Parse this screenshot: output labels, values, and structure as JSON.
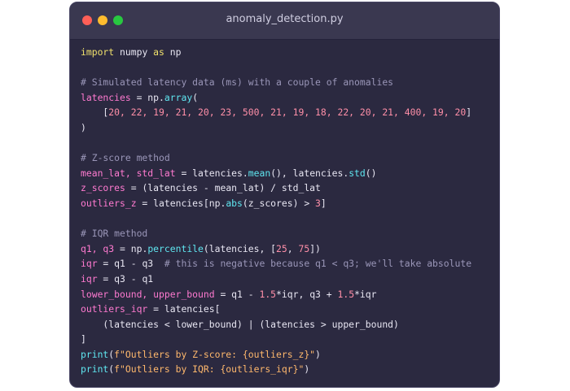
{
  "window": {
    "title": "anomaly_detection.py"
  },
  "code_lines": [
    [
      {
        "t": "import",
        "c": "kw"
      },
      {
        "t": " numpy ",
        "c": "plain"
      },
      {
        "t": "as",
        "c": "kw"
      },
      {
        "t": " np",
        "c": "plain"
      }
    ],
    [],
    [
      {
        "t": "# Simulated latency data (ms) with a couple of anomalies",
        "c": "cm"
      }
    ],
    [
      {
        "t": "latencies",
        "c": "pink"
      },
      {
        "t": " = np.",
        "c": "plain"
      },
      {
        "t": "array",
        "c": "fn"
      },
      {
        "t": "(",
        "c": "plain"
      }
    ],
    [
      {
        "t": "    [",
        "c": "plain"
      },
      {
        "t": "20, 22, 19, 21, 20, 23, 500, 21, 19, 18, 22, 20, 21, 400, 19, 20",
        "c": "num"
      },
      {
        "t": "]",
        "c": "plain"
      }
    ],
    [
      {
        "t": ")",
        "c": "plain"
      }
    ],
    [],
    [
      {
        "t": "# Z-score method",
        "c": "cm"
      }
    ],
    [
      {
        "t": "mean_lat, std_lat",
        "c": "pink"
      },
      {
        "t": " = latencies.",
        "c": "plain"
      },
      {
        "t": "mean",
        "c": "fn"
      },
      {
        "t": "(), latencies.",
        "c": "plain"
      },
      {
        "t": "std",
        "c": "fn"
      },
      {
        "t": "()",
        "c": "plain"
      }
    ],
    [
      {
        "t": "z_scores",
        "c": "pink"
      },
      {
        "t": " = (latencies - mean_lat) / std_lat",
        "c": "plain"
      }
    ],
    [
      {
        "t": "outliers_z",
        "c": "pink"
      },
      {
        "t": " = latencies[np.",
        "c": "plain"
      },
      {
        "t": "abs",
        "c": "fn"
      },
      {
        "t": "(z_scores) > ",
        "c": "plain"
      },
      {
        "t": "3",
        "c": "num"
      },
      {
        "t": "]",
        "c": "plain"
      }
    ],
    [],
    [
      {
        "t": "# IQR method",
        "c": "cm"
      }
    ],
    [
      {
        "t": "q1, q3",
        "c": "pink"
      },
      {
        "t": " = np.",
        "c": "plain"
      },
      {
        "t": "percentile",
        "c": "fn"
      },
      {
        "t": "(latencies, [",
        "c": "plain"
      },
      {
        "t": "25",
        "c": "num"
      },
      {
        "t": ", ",
        "c": "plain"
      },
      {
        "t": "75",
        "c": "num"
      },
      {
        "t": "])",
        "c": "plain"
      }
    ],
    [
      {
        "t": "iqr",
        "c": "pink"
      },
      {
        "t": " = q1 - q3  ",
        "c": "plain"
      },
      {
        "t": "# this is negative because q1 < q3; we'll take absolute",
        "c": "cm"
      }
    ],
    [
      {
        "t": "iqr",
        "c": "pink"
      },
      {
        "t": " = q3 - q1",
        "c": "plain"
      }
    ],
    [
      {
        "t": "lower_bound, upper_bound",
        "c": "pink"
      },
      {
        "t": " = q1 - ",
        "c": "plain"
      },
      {
        "t": "1.5",
        "c": "num"
      },
      {
        "t": "*iqr, q3 + ",
        "c": "plain"
      },
      {
        "t": "1.5",
        "c": "num"
      },
      {
        "t": "*iqr",
        "c": "plain"
      }
    ],
    [
      {
        "t": "outliers_iqr",
        "c": "pink"
      },
      {
        "t": " = latencies[",
        "c": "plain"
      }
    ],
    [
      {
        "t": "    (latencies < lower_bound) | (latencies > upper_bound)",
        "c": "plain"
      }
    ],
    [
      {
        "t": "]",
        "c": "plain"
      }
    ],
    [
      {
        "t": "print",
        "c": "fn"
      },
      {
        "t": "(",
        "c": "plain"
      },
      {
        "t": "f\"Outliers by Z-score: {outliers_z}\"",
        "c": "str"
      },
      {
        "t": ")",
        "c": "plain"
      }
    ],
    [
      {
        "t": "print",
        "c": "fn"
      },
      {
        "t": "(",
        "c": "plain"
      },
      {
        "t": "f\"Outliers by IQR: {outliers_iqr}\"",
        "c": "str"
      },
      {
        "t": ")",
        "c": "plain"
      }
    ]
  ],
  "colors": {
    "window_bg": "#2b2940",
    "titlebar_bg": "#3a3850",
    "close": "#ff5f57",
    "minimize": "#febc2e",
    "maximize": "#28c840"
  },
  "icons": {
    "close": "close-dot-icon",
    "minimize": "minimize-dot-icon",
    "maximize": "maximize-dot-icon"
  }
}
